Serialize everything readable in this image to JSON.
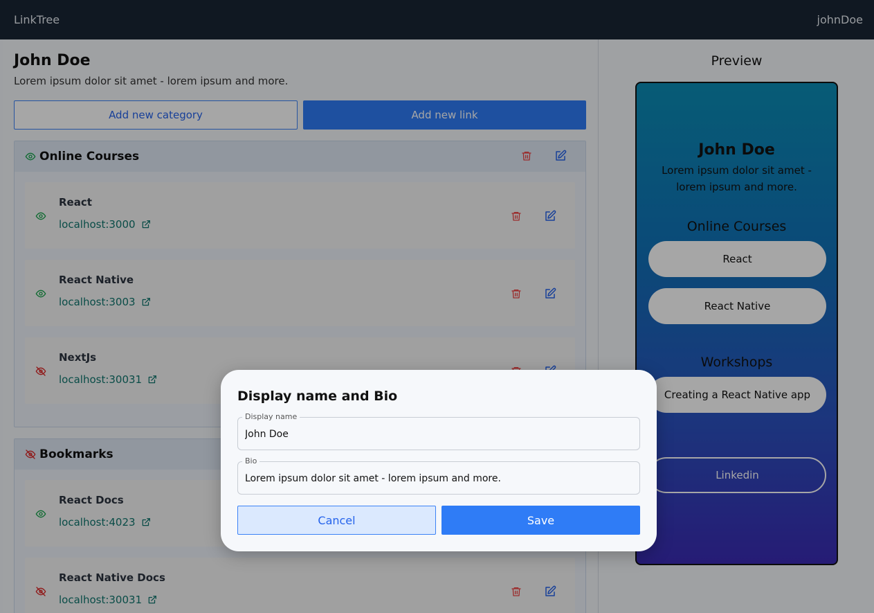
{
  "nav": {
    "brand": "LinkTree",
    "username": "johnDoe"
  },
  "profile": {
    "name": "John Doe",
    "bio": "Lorem ipsum dolor sit amet - lorem ipsum and more."
  },
  "actions": {
    "add_category": "Add new category",
    "add_link": "Add new link"
  },
  "categories": [
    {
      "title": "Online Courses",
      "visible": true,
      "links": [
        {
          "title": "React",
          "url": "localhost:3000",
          "visible": true
        },
        {
          "title": "React Native",
          "url": "localhost:3003",
          "visible": true
        },
        {
          "title": "NextJs",
          "url": "localhost:30031",
          "visible": false
        }
      ]
    },
    {
      "title": "Bookmarks",
      "visible": false,
      "links": [
        {
          "title": "React Docs",
          "url": "localhost:4023",
          "visible": true
        },
        {
          "title": "React Native Docs",
          "url": "localhost:30031",
          "visible": false
        }
      ]
    }
  ],
  "preview": {
    "label": "Preview",
    "name": "John Doe",
    "bio": "Lorem ipsum dolor sit amet - lorem ipsum and more.",
    "sections": [
      {
        "title": "Online Courses",
        "links": [
          "React",
          "React Native"
        ]
      },
      {
        "title": "Workshops",
        "links": [
          "Creating a React Native app"
        ]
      }
    ],
    "social": [
      "Linkedin"
    ]
  },
  "modal": {
    "title": "Display name and Bio",
    "display_name_label": "Display name",
    "display_name_value": "John Doe",
    "bio_label": "Bio",
    "bio_value": "Lorem ipsum dolor sit amet - lorem ipsum and more.",
    "cancel_label": "Cancel",
    "save_label": "Save"
  },
  "colors": {
    "nav": "#1a2635",
    "primary": "#2f7cf6",
    "eye_visible": "#16a34a",
    "eye_hidden": "#dc2626",
    "delete": "#ef4444",
    "edit": "#2563eb",
    "link_url": "#0f766e"
  }
}
